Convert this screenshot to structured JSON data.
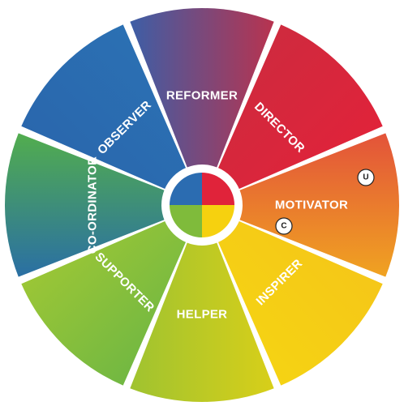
{
  "segments": [
    {
      "label": "REFORMER",
      "color_a": "#3d5ea6",
      "color_b": "#b8334f"
    },
    {
      "label": "DIRECTOR",
      "color_a": "#cf2a3e",
      "color_b": "#e0233a"
    },
    {
      "label": "MOTIVATOR",
      "color_a": "#e3533a",
      "color_b": "#f0a321"
    },
    {
      "label": "INSPIRER",
      "color_a": "#f5c718",
      "color_b": "#f5d313"
    },
    {
      "label": "HELPER",
      "color_a": "#d8cf19",
      "color_b": "#9fc330"
    },
    {
      "label": "SUPPORTER",
      "color_a": "#72b842",
      "color_b": "#9bc636"
    },
    {
      "label": "CO-ORDINATOR",
      "color_a": "#2a6fa4",
      "color_b": "#52ad4e"
    },
    {
      "label": "OBSERVER",
      "color_a": "#2a67ad",
      "color_b": "#2b70b3"
    }
  ],
  "center": {
    "colors": [
      "#e0233a",
      "#f6d10f",
      "#7fbb3b",
      "#2b6cb1"
    ]
  },
  "markers": [
    {
      "label": "U"
    },
    {
      "label": "C"
    }
  ]
}
